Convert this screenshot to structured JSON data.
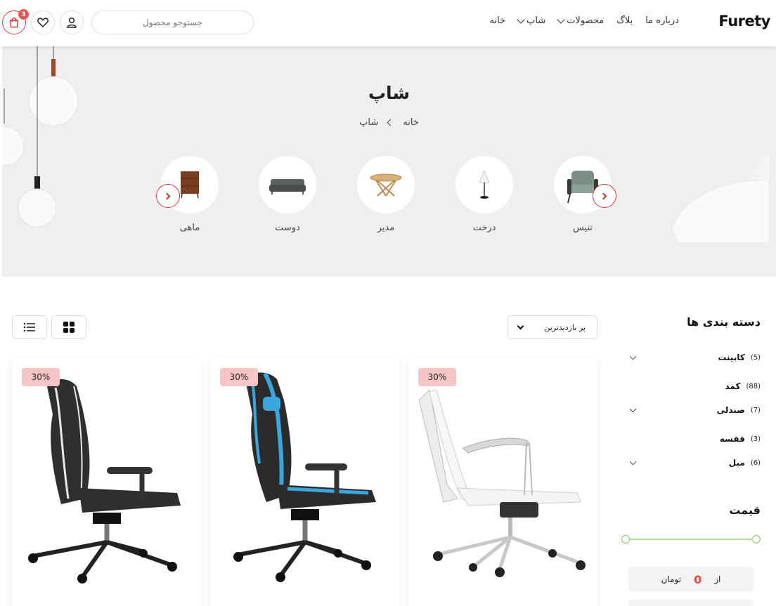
{
  "header": {
    "logo": "Furety",
    "nav": [
      {
        "label": "خانه",
        "has_dropdown": false
      },
      {
        "label": "شاپ",
        "has_dropdown": true
      },
      {
        "label": "محصولات",
        "has_dropdown": true
      },
      {
        "label": "بلاگ",
        "has_dropdown": false
      },
      {
        "label": "درباره ما",
        "has_dropdown": false
      }
    ],
    "search_placeholder": "جستوجو محصول",
    "cart_count": "3",
    "icons": [
      "user-icon",
      "heart-icon",
      "cart-icon"
    ]
  },
  "hero": {
    "title": "شاپ",
    "breadcrumb": [
      "خانه",
      "شاپ"
    ],
    "categories": [
      {
        "label": "تنیس",
        "icon": "armchair-icon"
      },
      {
        "label": "درخت",
        "icon": "lamp-icon"
      },
      {
        "label": "مدیر",
        "icon": "table-icon"
      },
      {
        "label": "دوست",
        "icon": "sofa-icon"
      },
      {
        "label": "ماهی",
        "icon": "drawer-icon"
      }
    ]
  },
  "toolbar": {
    "sort_label": "پر بازدیدترین"
  },
  "sidebar": {
    "categories_title": "دسته بندی ها",
    "categories": [
      {
        "name": "کابینت",
        "count": "(5)",
        "has_children": true
      },
      {
        "name": "کمد",
        "count": "(88)",
        "has_children": false
      },
      {
        "name": "صندلی",
        "count": "(7)",
        "has_children": true
      },
      {
        "name": "قفسه",
        "count": "(3)",
        "has_children": false
      },
      {
        "name": "مبل",
        "count": "(6)",
        "has_children": true
      }
    ],
    "price_title": "قیمت",
    "price_from_label": "از",
    "price_from_value": "0",
    "price_currency": "تومان"
  },
  "products": [
    {
      "discount": "30%",
      "image": "office-chair-white"
    },
    {
      "discount": "30%",
      "image": "gaming-chair-blue"
    },
    {
      "discount": "30%",
      "image": "gaming-chair-black"
    }
  ],
  "colors": {
    "accent": "#d9363e",
    "badge": "#f6c5c5",
    "range": "#8cc56a",
    "hero_bg": "#efefef"
  }
}
